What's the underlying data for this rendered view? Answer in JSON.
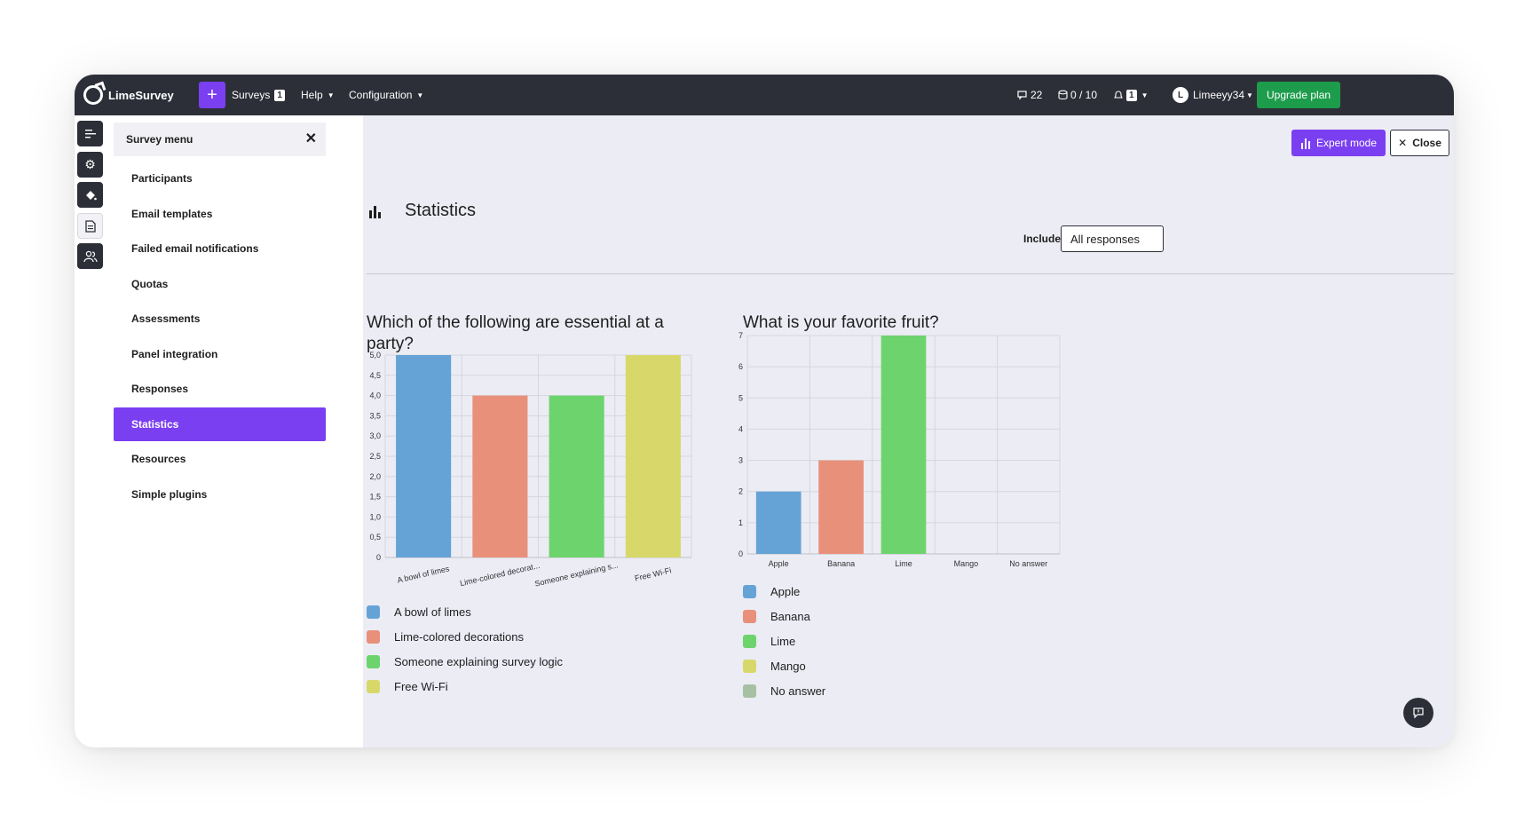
{
  "app": {
    "name": "LimeSurvey"
  },
  "topnav": {
    "plus_label": "+",
    "surveys_label": "Surveys",
    "surveys_badge": "1",
    "help_label": "Help",
    "configuration_label": "Configuration",
    "comments_count": "22",
    "storage_usage": "0 / 10",
    "notifications_count": "1",
    "avatar_initial": "L",
    "username": "Limeeyy34",
    "upgrade_label": "Upgrade plan"
  },
  "survey_menu": {
    "title": "Survey menu",
    "items": [
      {
        "label": "Participants"
      },
      {
        "label": "Email templates"
      },
      {
        "label": "Failed email notifications"
      },
      {
        "label": "Quotas"
      },
      {
        "label": "Assessments"
      },
      {
        "label": "Panel integration"
      },
      {
        "label": "Responses"
      },
      {
        "label": "Statistics",
        "active": true
      },
      {
        "label": "Resources"
      },
      {
        "label": "Simple plugins"
      }
    ]
  },
  "toolbar": {
    "expert_label": "Expert mode",
    "close_label": "Close"
  },
  "page": {
    "title": "Statistics",
    "include_label": "Include:",
    "include_value": "All responses"
  },
  "colors": {
    "accent": "#7b3ff2",
    "nav_bg": "#2d2f38",
    "upgrade": "#1d9c4c",
    "blue": "#65a3d6",
    "salmon": "#e8907a",
    "green": "#6dd46d",
    "yellow": "#d8d86a",
    "grey": "#a6c0a3"
  },
  "chart_data": [
    {
      "type": "bar",
      "title": "Which of the following are essential at a party?",
      "categories": [
        "A bowl of limes",
        "Lime-colored decorat...",
        "Someone explaining s...",
        "Free Wi-Fi"
      ],
      "values": [
        5.0,
        4.0,
        4.0,
        5.0
      ],
      "ylim": [
        0,
        5
      ],
      "yticks": [
        "0",
        "0,5",
        "1,0",
        "1,5",
        "2,0",
        "2,5",
        "3,0",
        "3,5",
        "4,0",
        "4,5",
        "5,0"
      ],
      "colors": [
        "#65a3d6",
        "#e8907a",
        "#6dd46d",
        "#d8d86a"
      ],
      "legend": [
        "A bowl of limes",
        "Lime-colored decorations",
        "Someone explaining survey logic",
        "Free Wi-Fi"
      ],
      "grid": true
    },
    {
      "type": "bar",
      "title": "What is your favorite fruit?",
      "categories": [
        "Apple",
        "Banana",
        "Lime",
        "Mango",
        "No answer"
      ],
      "values": [
        2,
        3,
        7,
        0,
        0
      ],
      "ylim": [
        0,
        7
      ],
      "yticks": [
        "0",
        "1",
        "2",
        "3",
        "4",
        "5",
        "6",
        "7"
      ],
      "colors": [
        "#65a3d6",
        "#e8907a",
        "#6dd46d",
        "#d8d86a",
        "#a6c0a3"
      ],
      "legend": [
        "Apple",
        "Banana",
        "Lime",
        "Mango",
        "No answer"
      ],
      "grid": true
    }
  ]
}
